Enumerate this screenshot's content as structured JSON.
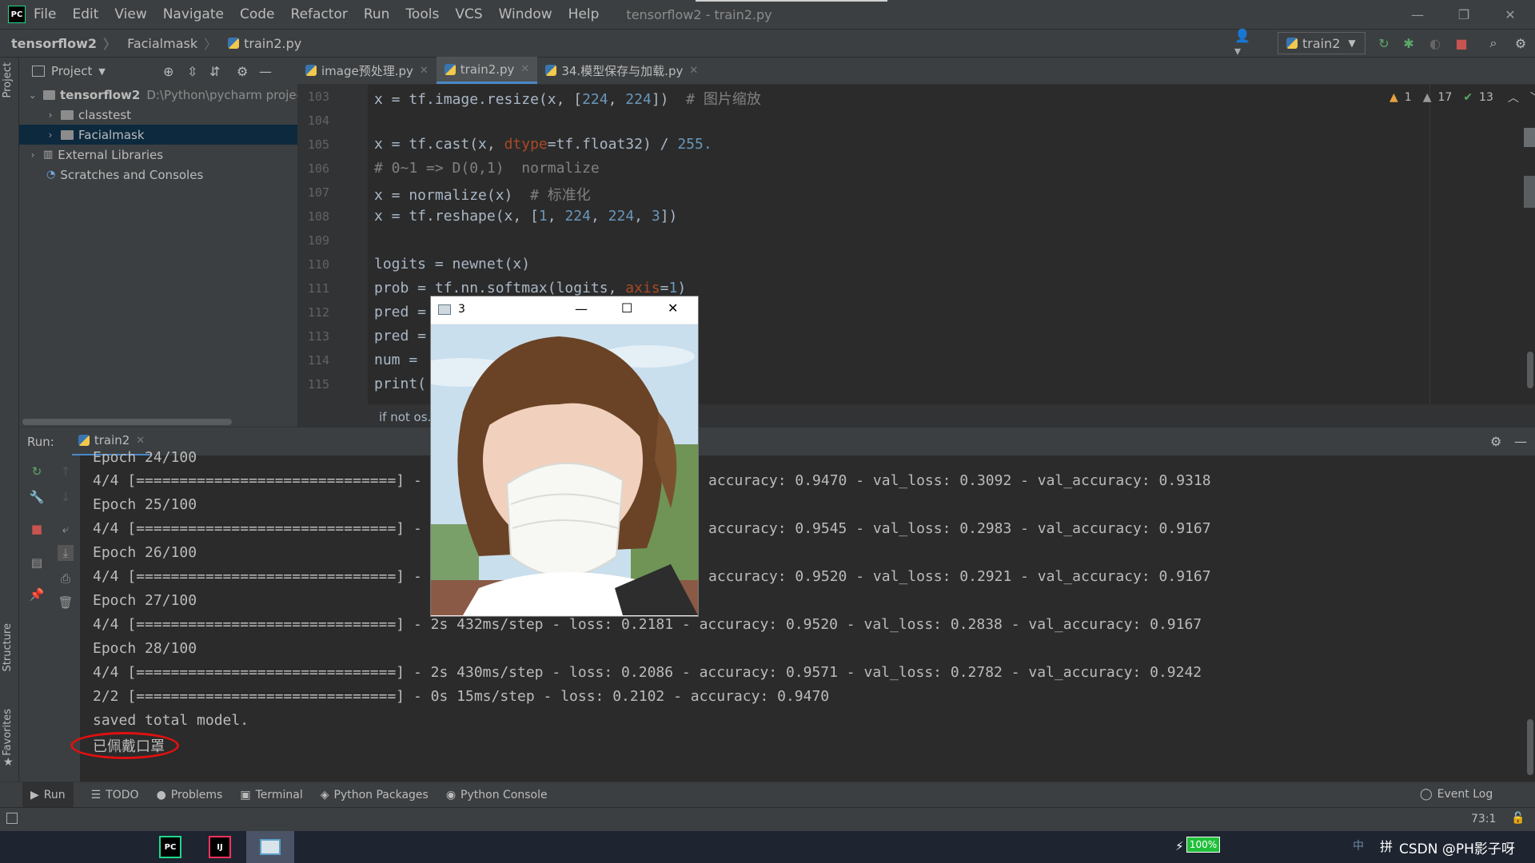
{
  "menu": {
    "items": [
      "File",
      "Edit",
      "View",
      "Navigate",
      "Code",
      "Refactor",
      "Run",
      "Tools",
      "VCS",
      "Window",
      "Help"
    ],
    "window_title": "tensorflow2 - train2.py"
  },
  "breadcrumb": {
    "project": "tensorflow2",
    "folder": "Facialmask",
    "file": "train2.py"
  },
  "toolbar": {
    "run_config": "train2"
  },
  "project_panel": {
    "title": "Project",
    "root_name": "tensorflow2",
    "root_path": "D:\\Python\\pycharm projec",
    "items": [
      "classtest",
      "Facialmask",
      "External Libraries",
      "Scratches and Consoles"
    ]
  },
  "editor": {
    "tabs": [
      "image预处理.py",
      "train2.py",
      "34.模型保存与加载.py"
    ],
    "inspections": {
      "warnings_a": "1",
      "warnings_b": "17",
      "ok": "13"
    },
    "line_numbers": [
      "103",
      "104",
      "105",
      "106",
      "107",
      "108",
      "109",
      "110",
      "111",
      "112",
      "113",
      "114",
      "115"
    ],
    "hint": "if not os."
  },
  "code": {
    "l103_a": "x = tf.image.resize(x, [",
    "l103_n1": "224",
    "l103_b": ", ",
    "l103_n2": "224",
    "l103_c": "])  ",
    "l103_cmt": "# 图片缩放",
    "l105_a": "x = tf.cast(x, ",
    "l105_kw": "dtype",
    "l105_b": "=tf.float32) / ",
    "l105_n": "255.",
    "l106_cmt": "# 0~1 => D(0,1)  normalize",
    "l107_a": "x = normalize(x)  ",
    "l107_cmt": "# 标准化",
    "l108_a": "x = tf.reshape(x, [",
    "l108_n1": "1",
    "l108_b": ", ",
    "l108_n2": "224",
    "l108_c": ", ",
    "l108_n3": "224",
    "l108_d": ", ",
    "l108_n4": "3",
    "l108_e": "])",
    "l110": "logits = newnet(x)",
    "l111_a": "prob = tf.nn.softmax(logits, ",
    "l111_kw": "axis",
    "l111_b": "=",
    "l111_n": "1",
    "l111_c": ")",
    "l112": "pred =",
    "l113": "pred =",
    "l114": "num = ",
    "l115": "print("
  },
  "run_panel": {
    "label": "Run:",
    "tab": "train2",
    "lines_left": [
      "Epoch 24/100",
      "4/4 [==============================] -",
      "Epoch 25/100",
      "4/4 [==============================] -",
      "Epoch 26/100",
      "4/4 [==============================] -",
      "Epoch 27/100",
      "4/4 [==============================] - 2s 432ms/step - loss: 0.2181 - accuracy: 0.9520 - val_loss: 0.2838 - val_accuracy: 0.9167",
      "Epoch 28/100",
      "4/4 [==============================] - 2s 430ms/step - loss: 0.2086 - accuracy: 0.9571 - val_loss: 0.2782 - val_accuracy: 0.9242",
      "2/2 [==============================] - 0s 15ms/step - loss: 0.2102 - accuracy: 0.9470",
      "saved total model.",
      "已佩戴口罩"
    ],
    "lines_right": [
      "accuracy: 0.9470 - val_loss: 0.3092 - val_accuracy: 0.9318",
      "accuracy: 0.9545 - val_loss: 0.2983 - val_accuracy: 0.9167",
      "accuracy: 0.9520 - val_loss: 0.2921 - val_accuracy: 0.9167"
    ]
  },
  "bottom_tools": [
    "Run",
    "TODO",
    "Problems",
    "Terminal",
    "Python Packages",
    "Python Console"
  ],
  "event_log": "Event Log",
  "status": {
    "position": "73:1"
  },
  "side_labels": {
    "project": "Project",
    "structure": "Structure",
    "favorites": "Favorites"
  },
  "popup": {
    "title": "3"
  },
  "taskbar": {
    "battery": "100%",
    "watermark": "CSDN @PH影子呀"
  },
  "colors": {
    "accent": "#4a88c7",
    "annotation": "#e01010"
  }
}
